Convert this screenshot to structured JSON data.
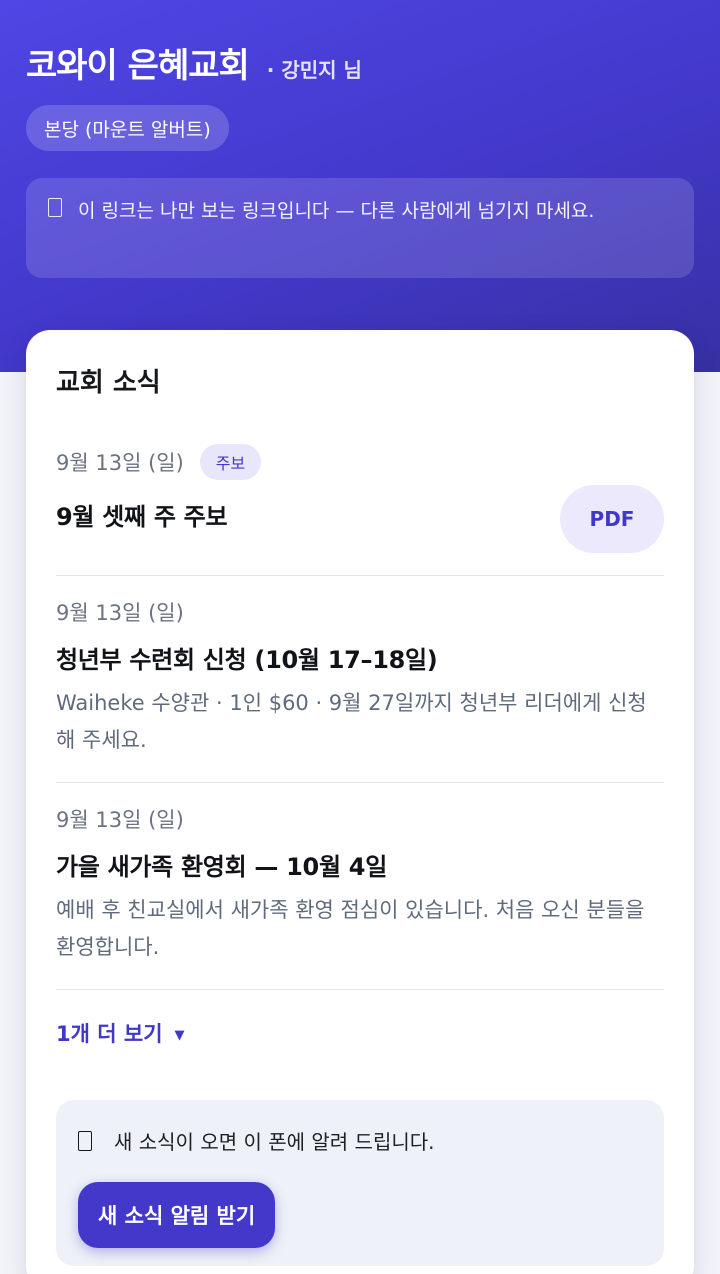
{
  "header": {
    "church_name": "코와이 은혜교회",
    "user_name": "· 강민지 님",
    "campus": "본당 (마운트 알버트)",
    "notice_icon": "lock-icon",
    "notice": "이 링크는 나만 보는 링크입니다 — 다른 사람에게 넘기지 마세요."
  },
  "news": {
    "section_title": "교회 소식",
    "items": [
      {
        "date": "9월 13일 (일)",
        "tag": "주보",
        "title": "9월 셋째 주 주보",
        "action": "PDF"
      },
      {
        "date": "9월 13일 (일)",
        "title": "청년부 수련회 신청 (10월 17–18일)",
        "desc": "Waiheke 수양관 · 1인 $60 · 9월 27일까지 청년부 리더에게 신청해 주세요."
      },
      {
        "date": "9월 13일 (일)",
        "title": "가을 새가족 환영회 — 10월 4일",
        "desc": "예배 후 친교실에서 새가족 환영 점심이 있습니다. 처음 오신 분들을 환영합니다."
      }
    ],
    "more_label": "1개 더 보기",
    "more_icon": "chevron-down-icon"
  },
  "subscribe": {
    "icon": "bell-icon",
    "text": "새 소식이 오면 이 폰에 알려 드립니다.",
    "button_label": "새 소식 알림 받기"
  },
  "colors": {
    "brand": "#4338ca",
    "hero_start": "#4f46e5",
    "hero_end": "#3730a3",
    "tag_bg": "#e8e6fb",
    "background": "#f1f3f8"
  }
}
